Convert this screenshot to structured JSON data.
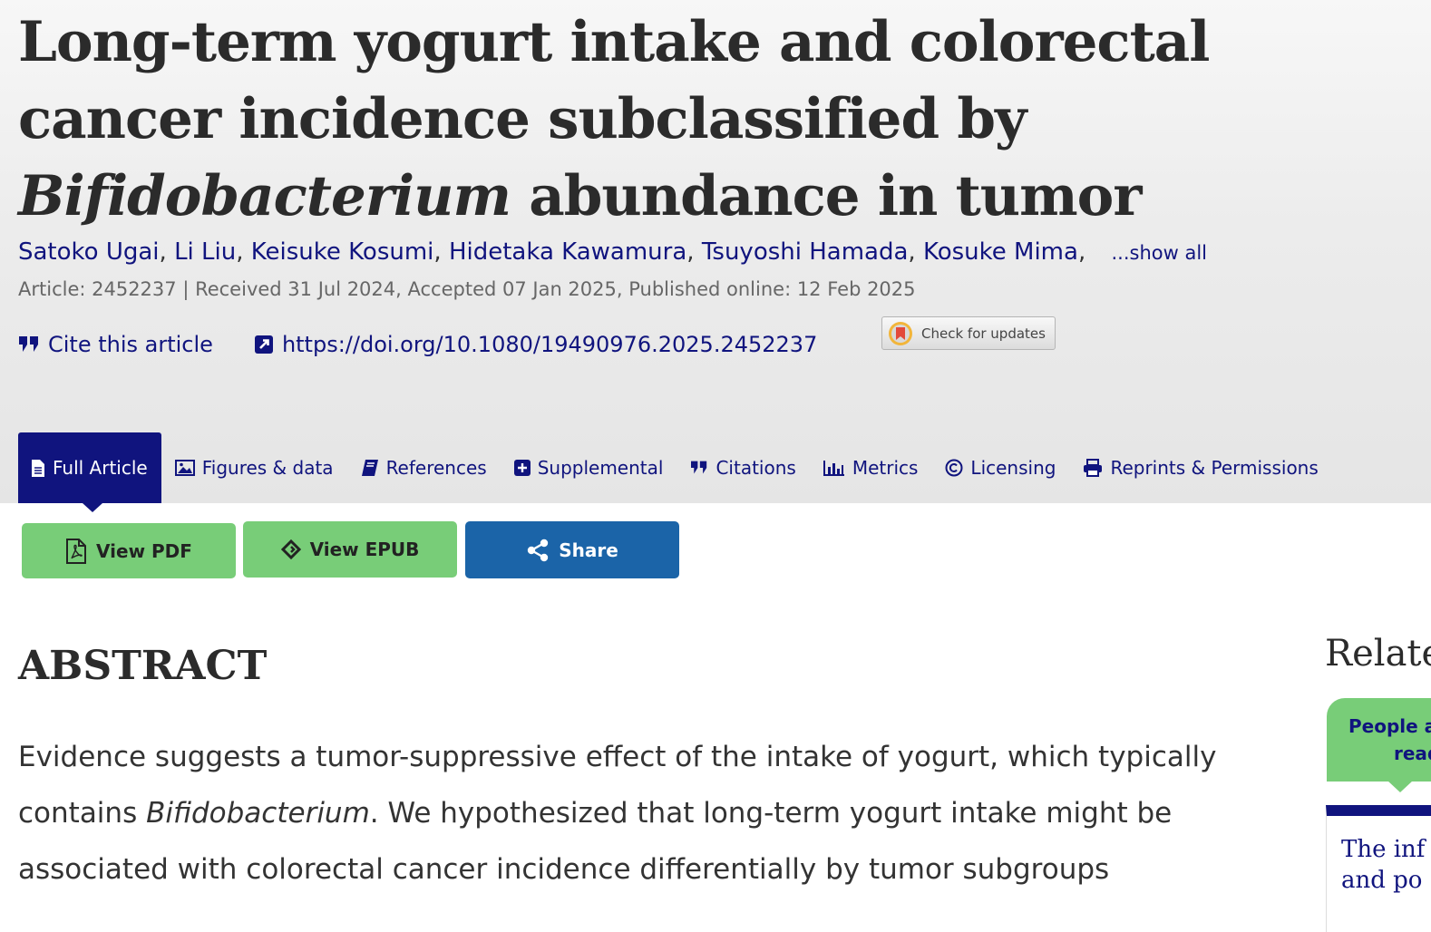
{
  "article": {
    "title_part1": "Long-term yogurt intake and colorectal cancer incidence subclassified by ",
    "title_italic": "Bifidobacterium",
    "title_part2": " abundance in tumor",
    "authors": [
      "Satoko Ugai",
      "Li Liu",
      "Keisuke Kosumi",
      "Hidetaka Kawamura",
      "Tsuyoshi Hamada",
      "Kosuke Mima"
    ],
    "show_all": "...show all",
    "meta": "Article: 2452237 | Received 31 Jul 2024, Accepted 07 Jan 2025, Published online: 12 Feb 2025",
    "cite": "Cite this article",
    "doi": "https://doi.org/10.1080/19490976.2025.2452237",
    "check_updates": "Check for updates"
  },
  "tabs": [
    {
      "label": "Full Article",
      "icon": "document-icon"
    },
    {
      "label": "Figures & data",
      "icon": "image-icon"
    },
    {
      "label": "References",
      "icon": "book-icon"
    },
    {
      "label": "Supplemental",
      "icon": "plus-square-icon"
    },
    {
      "label": "Citations",
      "icon": "quote-icon"
    },
    {
      "label": "Metrics",
      "icon": "bar-chart-icon"
    },
    {
      "label": "Licensing",
      "icon": "copyright-icon"
    },
    {
      "label": "Reprints & Permissions",
      "icon": "printer-icon"
    }
  ],
  "buttons": {
    "pdf": "View PDF",
    "epub": "View EPUB",
    "share": "Share"
  },
  "abstract": {
    "heading": "ABSTRACT",
    "p1": "Evidence suggests a tumor-suppressive effect of the intake of yogurt, which typically contains ",
    "p_italic": "Bifidobacterium",
    "p2": ". We hypothesized that long-term yogurt intake might be associated with colorectal cancer incidence differentially by tumor subgroups"
  },
  "sidebar": {
    "related_heading": "Relate",
    "card_line1": "People a",
    "card_line2": "read",
    "article_line1": "The inf",
    "article_line2": "and po"
  },
  "colors": {
    "navy": "#10147e",
    "green": "#78cd78",
    "blue": "#1b64a8"
  }
}
